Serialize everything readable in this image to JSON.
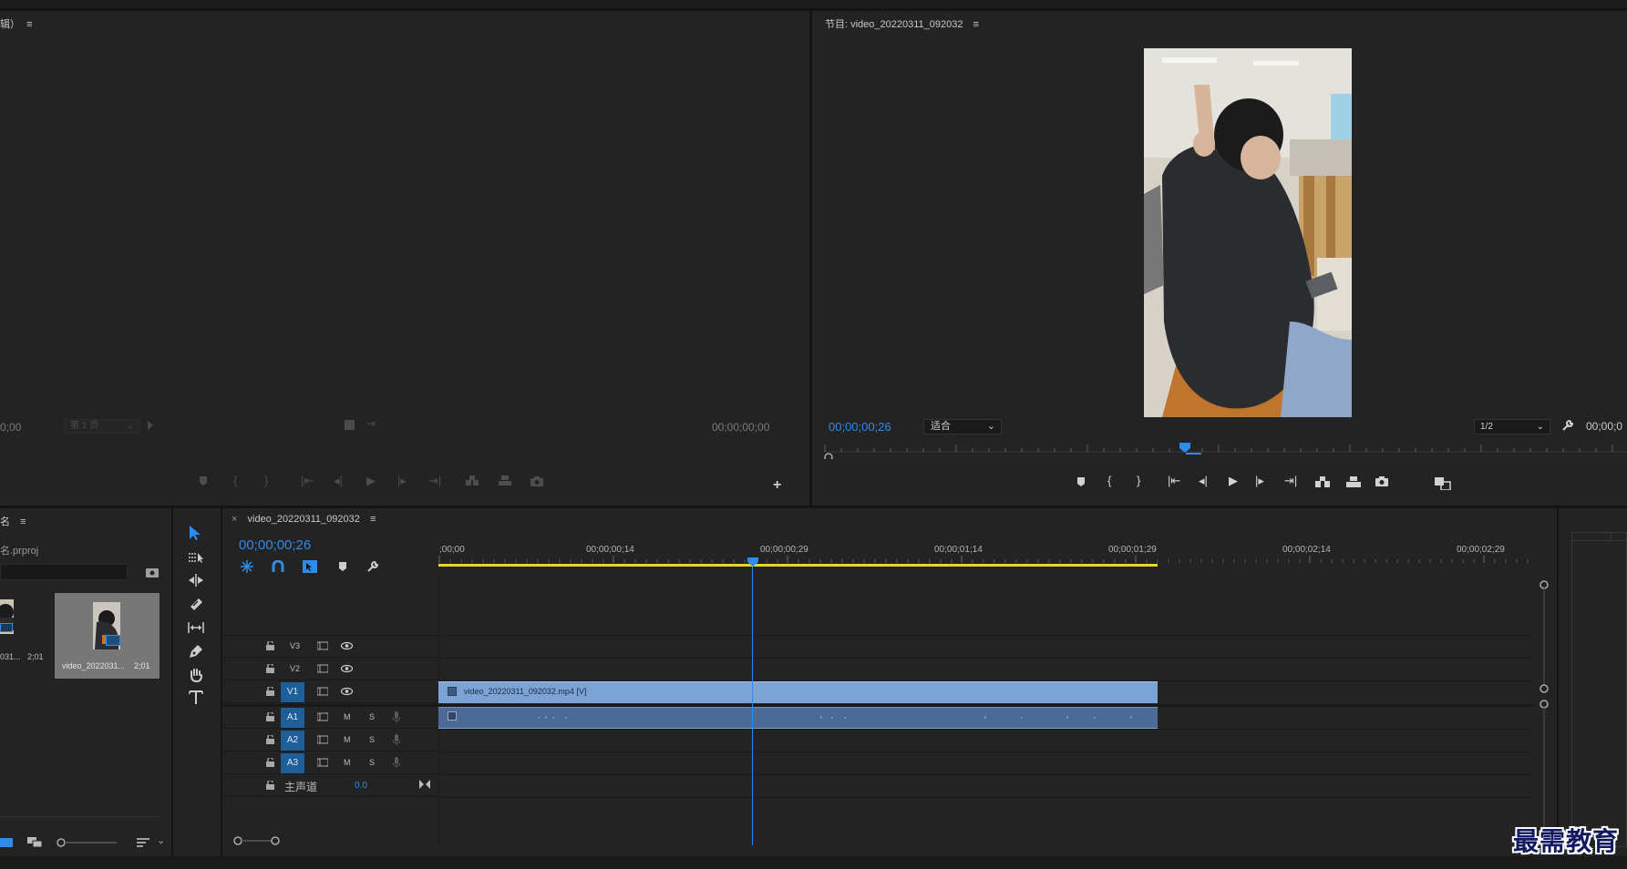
{
  "source_monitor": {
    "title": "辑）",
    "timecode_left": "0;00",
    "page_label": "第 1 页",
    "timecode_right": "00;00;00;00"
  },
  "program_monitor": {
    "title": "节目: video_20220311_092032",
    "timecode": "00;00;00;26",
    "fit_label": "适合",
    "resolution": "1/2",
    "timecode_right": "00;00;0"
  },
  "project": {
    "title": "名",
    "file": "名.prproj",
    "items": [
      {
        "label": "031...",
        "duration": "2;01"
      },
      {
        "label": "video_2022031...",
        "duration": "2;01"
      }
    ]
  },
  "sequence": {
    "tab_label": "video_20220311_092032",
    "close_glyph": "×",
    "timecode": "00;00;00;26",
    "ruler_labels": [
      ";00;00",
      "00;00;00;14",
      "00;00;00;29",
      "00;00;01;14",
      "00;00;01;29",
      "00;00;02;14",
      "00;00;02;29"
    ],
    "video_tracks": [
      "V3",
      "V2",
      "V1"
    ],
    "audio_tracks": [
      "A1",
      "A2",
      "A3"
    ],
    "mute_label": "M",
    "solo_label": "S",
    "master_label": "主声道",
    "master_value": "0.0",
    "clip_label": "video_20220311_092032.mp4 [V]"
  },
  "watermark": "最需教育",
  "colors": {
    "accent": "#2d8ceb",
    "clip_video": "#7ba3d6",
    "clip_audio": "#5a86c2",
    "work_area": "#e8d62e",
    "track_target": "#1e5f9a"
  }
}
